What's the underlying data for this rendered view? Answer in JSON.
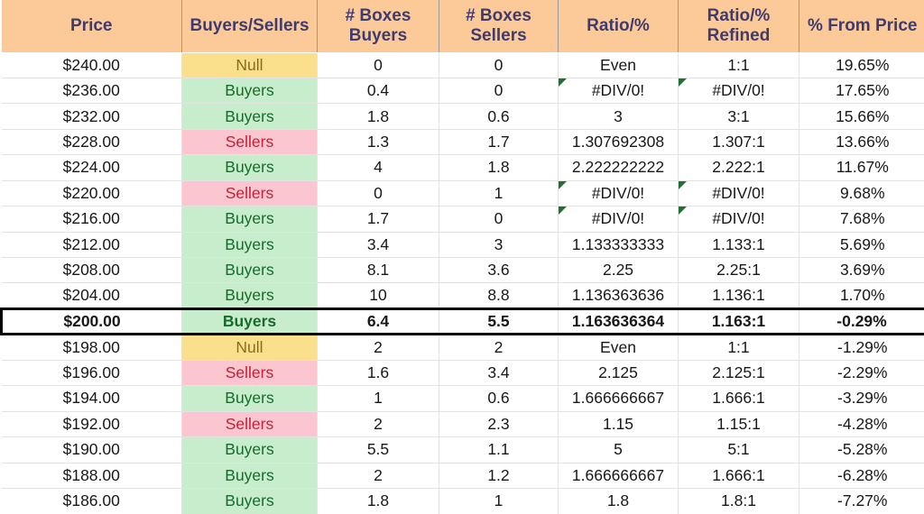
{
  "table": {
    "headers": [
      "Price",
      "Buyers/Sellers",
      "# Boxes\nBuyers",
      "# Boxes\nSellers",
      "Ratio/%",
      "Ratio/%\nRefined",
      "% From Price"
    ],
    "colors": {
      "header_bg": "#FCCA98",
      "header_text": "#3F3B6E",
      "buyers_bg": "#C8EDCC",
      "buyers_text": "#176B2B",
      "sellers_bg": "#FBC6CF",
      "sellers_text": "#C42139",
      "null_bg": "#FAE08C",
      "null_text": "#8A6B1C",
      "comment_marker": "#1E7033",
      "focus_border": "#000000"
    },
    "rows": [
      {
        "price": "$240.00",
        "sentiment": "Null",
        "sentiment_kind": "null",
        "boxes_buyers": "0",
        "boxes_sellers": "0",
        "ratio": "Even",
        "ratio_comment": false,
        "ratio_refined": "1:1",
        "ratio_refined_comment": false,
        "pct_from_price": "19.65%",
        "focus": false
      },
      {
        "price": "$236.00",
        "sentiment": "Buyers",
        "sentiment_kind": "buyers",
        "boxes_buyers": "0.4",
        "boxes_sellers": "0",
        "ratio": "#DIV/0!",
        "ratio_comment": true,
        "ratio_refined": "#DIV/0!",
        "ratio_refined_comment": true,
        "pct_from_price": "17.65%",
        "focus": false
      },
      {
        "price": "$232.00",
        "sentiment": "Buyers",
        "sentiment_kind": "buyers",
        "boxes_buyers": "1.8",
        "boxes_sellers": "0.6",
        "ratio": "3",
        "ratio_comment": false,
        "ratio_refined": "3:1",
        "ratio_refined_comment": false,
        "pct_from_price": "15.66%",
        "focus": false
      },
      {
        "price": "$228.00",
        "sentiment": "Sellers",
        "sentiment_kind": "sellers",
        "boxes_buyers": "1.3",
        "boxes_sellers": "1.7",
        "ratio": "1.307692308",
        "ratio_comment": false,
        "ratio_refined": "1.307:1",
        "ratio_refined_comment": false,
        "pct_from_price": "13.66%",
        "focus": false
      },
      {
        "price": "$224.00",
        "sentiment": "Buyers",
        "sentiment_kind": "buyers",
        "boxes_buyers": "4",
        "boxes_sellers": "1.8",
        "ratio": "2.222222222",
        "ratio_comment": false,
        "ratio_refined": "2.222:1",
        "ratio_refined_comment": false,
        "pct_from_price": "11.67%",
        "focus": false
      },
      {
        "price": "$220.00",
        "sentiment": "Sellers",
        "sentiment_kind": "sellers",
        "boxes_buyers": "0",
        "boxes_sellers": "1",
        "ratio": "#DIV/0!",
        "ratio_comment": true,
        "ratio_refined": "#DIV/0!",
        "ratio_refined_comment": true,
        "pct_from_price": "9.68%",
        "focus": false
      },
      {
        "price": "$216.00",
        "sentiment": "Buyers",
        "sentiment_kind": "buyers",
        "boxes_buyers": "1.7",
        "boxes_sellers": "0",
        "ratio": "#DIV/0!",
        "ratio_comment": true,
        "ratio_refined": "#DIV/0!",
        "ratio_refined_comment": true,
        "pct_from_price": "7.68%",
        "focus": false
      },
      {
        "price": "$212.00",
        "sentiment": "Buyers",
        "sentiment_kind": "buyers",
        "boxes_buyers": "3.4",
        "boxes_sellers": "3",
        "ratio": "1.133333333",
        "ratio_comment": false,
        "ratio_refined": "1.133:1",
        "ratio_refined_comment": false,
        "pct_from_price": "5.69%",
        "focus": false
      },
      {
        "price": "$208.00",
        "sentiment": "Buyers",
        "sentiment_kind": "buyers",
        "boxes_buyers": "8.1",
        "boxes_sellers": "3.6",
        "ratio": "2.25",
        "ratio_comment": false,
        "ratio_refined": "2.25:1",
        "ratio_refined_comment": false,
        "pct_from_price": "3.69%",
        "focus": false
      },
      {
        "price": "$204.00",
        "sentiment": "Buyers",
        "sentiment_kind": "buyers",
        "boxes_buyers": "10",
        "boxes_sellers": "8.8",
        "ratio": "1.136363636",
        "ratio_comment": false,
        "ratio_refined": "1.136:1",
        "ratio_refined_comment": false,
        "pct_from_price": "1.70%",
        "focus": false
      },
      {
        "price": "$200.00",
        "sentiment": "Buyers",
        "sentiment_kind": "buyers",
        "boxes_buyers": "6.4",
        "boxes_sellers": "5.5",
        "ratio": "1.163636364",
        "ratio_comment": false,
        "ratio_refined": "1.163:1",
        "ratio_refined_comment": false,
        "pct_from_price": "-0.29%",
        "focus": true
      },
      {
        "price": "$198.00",
        "sentiment": "Null",
        "sentiment_kind": "null",
        "boxes_buyers": "2",
        "boxes_sellers": "2",
        "ratio": "Even",
        "ratio_comment": false,
        "ratio_refined": "1:1",
        "ratio_refined_comment": false,
        "pct_from_price": "-1.29%",
        "focus": false
      },
      {
        "price": "$196.00",
        "sentiment": "Sellers",
        "sentiment_kind": "sellers",
        "boxes_buyers": "1.6",
        "boxes_sellers": "3.4",
        "ratio": "2.125",
        "ratio_comment": false,
        "ratio_refined": "2.125:1",
        "ratio_refined_comment": false,
        "pct_from_price": "-2.29%",
        "focus": false
      },
      {
        "price": "$194.00",
        "sentiment": "Buyers",
        "sentiment_kind": "buyers",
        "boxes_buyers": "1",
        "boxes_sellers": "0.6",
        "ratio": "1.666666667",
        "ratio_comment": false,
        "ratio_refined": "1.666:1",
        "ratio_refined_comment": false,
        "pct_from_price": "-3.29%",
        "focus": false
      },
      {
        "price": "$192.00",
        "sentiment": "Sellers",
        "sentiment_kind": "sellers",
        "boxes_buyers": "2",
        "boxes_sellers": "2.3",
        "ratio": "1.15",
        "ratio_comment": false,
        "ratio_refined": "1.15:1",
        "ratio_refined_comment": false,
        "pct_from_price": "-4.28%",
        "focus": false
      },
      {
        "price": "$190.00",
        "sentiment": "Buyers",
        "sentiment_kind": "buyers",
        "boxes_buyers": "5.5",
        "boxes_sellers": "1.1",
        "ratio": "5",
        "ratio_comment": false,
        "ratio_refined": "5:1",
        "ratio_refined_comment": false,
        "pct_from_price": "-5.28%",
        "focus": false
      },
      {
        "price": "$188.00",
        "sentiment": "Buyers",
        "sentiment_kind": "buyers",
        "boxes_buyers": "2",
        "boxes_sellers": "1.2",
        "ratio": "1.666666667",
        "ratio_comment": false,
        "ratio_refined": "1.666:1",
        "ratio_refined_comment": false,
        "pct_from_price": "-6.28%",
        "focus": false
      },
      {
        "price": "$186.00",
        "sentiment": "Buyers",
        "sentiment_kind": "buyers",
        "boxes_buyers": "1.8",
        "boxes_sellers": "1",
        "ratio": "1.8",
        "ratio_comment": false,
        "ratio_refined": "1.8:1",
        "ratio_refined_comment": false,
        "pct_from_price": "-7.27%",
        "focus": false
      }
    ]
  }
}
